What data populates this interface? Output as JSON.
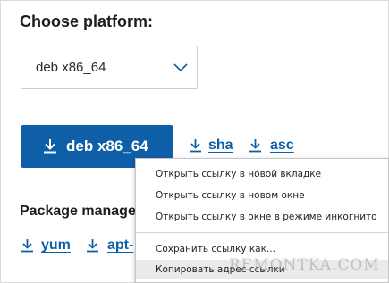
{
  "platform": {
    "heading": "Choose platform:",
    "selected": "deb x86_64"
  },
  "download": {
    "button_label": "deb x86_64",
    "sha_label": "sha",
    "asc_label": "asc"
  },
  "package_managers": {
    "heading": "Package manage",
    "yum_label": "yum",
    "apt_label": "apt-"
  },
  "context_menu": {
    "items": [
      "Открыть ссылку в новой вкладке",
      "Открыть ссылку в новом окне",
      "Открыть ссылку в окне в режиме инкогнито",
      "Сохранить ссылку как...",
      "Копировать адрес ссылки"
    ],
    "highlighted_index": 4
  },
  "watermark": "REMONTKA.COM",
  "colors": {
    "accent": "#0f5fa8",
    "menu_highlight": "#eaeaea"
  }
}
